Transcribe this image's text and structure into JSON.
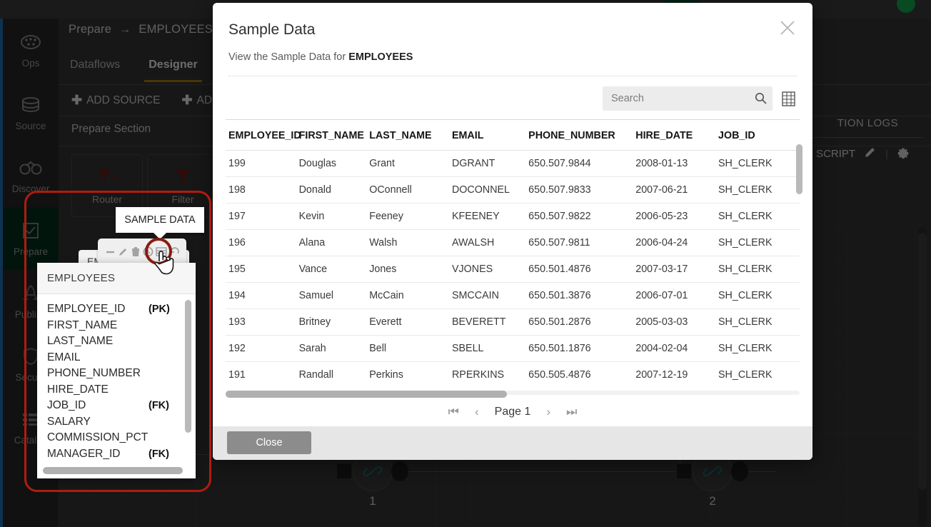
{
  "app": {
    "sidebar": {
      "items": [
        {
          "label": "Ops",
          "icon": "gauge-icon",
          "active": false
        },
        {
          "label": "Source",
          "icon": "database-icon",
          "active": false
        },
        {
          "label": "Discover",
          "icon": "binoculars-icon",
          "active": false
        },
        {
          "label": "Prepare",
          "icon": "checkbox-square-icon",
          "active": true
        },
        {
          "label": "Publish",
          "icon": "rocket-icon",
          "active": false
        },
        {
          "label": "Secure",
          "icon": "shield-icon",
          "active": false
        },
        {
          "label": "Catalog",
          "icon": "list-icon",
          "active": false
        }
      ]
    },
    "breadcrumb": {
      "root": "Prepare",
      "separator": "→",
      "current": "EMPLOYEES_JOIN"
    },
    "tabs": [
      {
        "label": "Dataflows",
        "active": false
      },
      {
        "label": "Designer",
        "active": true
      }
    ],
    "toolbar": {
      "add_source": "ADD SOURCE",
      "add_second": "AD",
      "plus": "✚"
    },
    "section_title": "Prepare Section",
    "right_panel": {
      "execution_logs": "TION LOGS",
      "script_label": "SCRIPT",
      "edit_icon": "pencil-icon",
      "settings_icon": "gear-icon",
      "divider": "|"
    },
    "palette": [
      {
        "label": "Router",
        "icon": "router-funnel-icon"
      },
      {
        "label": "Filter",
        "icon": "filter-funnel-icon"
      }
    ],
    "canvas": {
      "join_nodes": [
        {
          "label": "1",
          "icon": "link-chain-icon"
        },
        {
          "label": "2",
          "icon": "link-chain-icon"
        }
      ]
    },
    "node_card": {
      "title": "EM"
    },
    "node_toolbar": {
      "icons": [
        "minus-icon",
        "pencil-icon",
        "trash-icon",
        "clock-icon",
        "table-grid-icon",
        "undo-icon"
      ]
    },
    "tooltip": {
      "text": "SAMPLE DATA"
    },
    "dropdown": {
      "title": "EMPLOYEES",
      "columns": [
        {
          "name": "EMPLOYEE_ID",
          "key": "(PK)"
        },
        {
          "name": "FIRST_NAME",
          "key": ""
        },
        {
          "name": "LAST_NAME",
          "key": ""
        },
        {
          "name": "EMAIL",
          "key": ""
        },
        {
          "name": "PHONE_NUMBER",
          "key": ""
        },
        {
          "name": "HIRE_DATE",
          "key": ""
        },
        {
          "name": "JOB_ID",
          "key": "(FK)"
        },
        {
          "name": "SALARY",
          "key": ""
        },
        {
          "name": "COMMISSION_PCT",
          "key": ""
        },
        {
          "name": "MANAGER_ID",
          "key": "(FK)"
        }
      ]
    }
  },
  "dialog": {
    "title": "Sample Data",
    "subtitle_prefix": "View the Sample Data for ",
    "subtitle_entity": "EMPLOYEES",
    "close_icon": "close-x-icon",
    "search": {
      "placeholder": "Search",
      "value": "",
      "icon": "search-icon"
    },
    "grid_toggle_icon": "table-grid-icon",
    "table": {
      "sort_column": "EMPLOYEE_ID",
      "sort_direction": "desc",
      "sort_glyph": "↓",
      "headers": [
        "EMPLOYEE_ID",
        "FIRST_NAME",
        "LAST_NAME",
        "EMAIL",
        "PHONE_NUMBER",
        "HIRE_DATE",
        "JOB_ID"
      ],
      "rows": [
        [
          "199",
          "Douglas",
          "Grant",
          "DGRANT",
          "650.507.9844",
          "2008-01-13",
          "SH_CLERK"
        ],
        [
          "198",
          "Donald",
          "OConnell",
          "DOCONNEL",
          "650.507.9833",
          "2007-06-21",
          "SH_CLERK"
        ],
        [
          "197",
          "Kevin",
          "Feeney",
          "KFEENEY",
          "650.507.9822",
          "2006-05-23",
          "SH_CLERK"
        ],
        [
          "196",
          "Alana",
          "Walsh",
          "AWALSH",
          "650.507.9811",
          "2006-04-24",
          "SH_CLERK"
        ],
        [
          "195",
          "Vance",
          "Jones",
          "VJONES",
          "650.501.4876",
          "2007-03-17",
          "SH_CLERK"
        ],
        [
          "194",
          "Samuel",
          "McCain",
          "SMCCAIN",
          "650.501.3876",
          "2006-07-01",
          "SH_CLERK"
        ],
        [
          "193",
          "Britney",
          "Everett",
          "BEVERETT",
          "650.501.2876",
          "2005-03-03",
          "SH_CLERK"
        ],
        [
          "192",
          "Sarah",
          "Bell",
          "SBELL",
          "650.501.1876",
          "2004-02-04",
          "SH_CLERK"
        ],
        [
          "191",
          "Randall",
          "Perkins",
          "RPERKINS",
          "650.505.4876",
          "2007-12-19",
          "SH_CLERK"
        ]
      ]
    },
    "pager": {
      "first": "⏮",
      "prev": "‹",
      "label": "Page 1",
      "next": "›",
      "last": "⏭"
    },
    "footer": {
      "close_label": "Close"
    }
  },
  "colors": {
    "accent_green": "#12a44b",
    "tab_underline": "#a07a10",
    "annotation_red": "#b01c0e",
    "app_dark": "#333333",
    "sidebar_dark": "#262626",
    "active_sidebar": "#06301b",
    "button_gray": "#8c8c8c",
    "edge_blue": "#1f6fb2"
  }
}
